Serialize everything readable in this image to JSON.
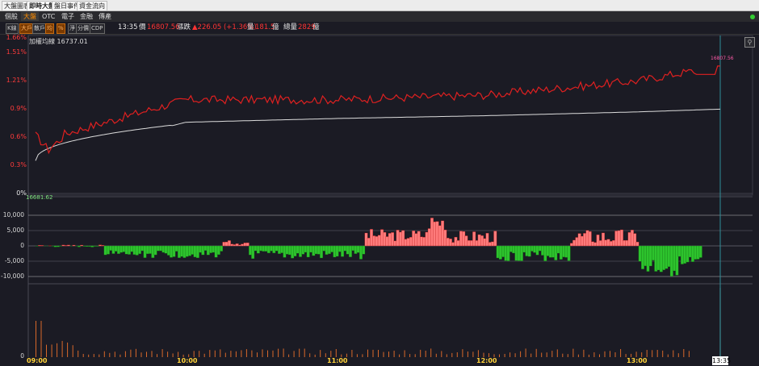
{
  "top_tabs": [
    "大盤圖表",
    "即時大盤",
    "盤日事件",
    "資金流向"
  ],
  "sub_tabs": [
    "個股",
    "大盤",
    "OTC",
    "電子",
    "金融",
    "傳產"
  ],
  "toolbar": {
    "buttons": [
      "K線",
      "大戶",
      "散戶",
      "均",
      "%",
      "淨",
      "分價",
      "CDP"
    ],
    "active_buttons": [
      "大戶",
      "均",
      "%"
    ]
  },
  "quote": {
    "time": "13:35",
    "price_label": "價",
    "price": "16807.56",
    "change_label": "漲跌",
    "change": "▲226.05 (+1.36%)",
    "volume_label": "量",
    "volume": "181.5",
    "volume_unit": "億",
    "total_label": "總量",
    "total": "2829",
    "total_unit": "億"
  },
  "main_chart": {
    "header_label": "加權均線 16737.01",
    "last_price_label": "16807.56",
    "y_ticks": [
      "1.66%",
      "1.51%",
      "1.21%",
      "0.9%",
      "0.6%",
      "0.3%",
      "0%"
    ],
    "colors": {
      "price_line": "#e02020",
      "avg_line": "#dcdcdc",
      "background": "#1b1b24"
    }
  },
  "flow_chart": {
    "top_label": "16681.62",
    "y_ticks": [
      "10,000",
      "5,000",
      "0",
      "-5,000",
      "-10,000"
    ],
    "colors": {
      "positive": "#ff7b7b",
      "negative": "#2dc32d"
    }
  },
  "volume_chart": {
    "y_ticks": [
      "0"
    ],
    "color": "#d8682a"
  },
  "x_axis": {
    "ticks": [
      "09:00",
      "10:00",
      "11:00",
      "12:00",
      "13:00"
    ],
    "current_time_box": "13:35"
  },
  "chart_data": {
    "type": "line",
    "title": "",
    "x": [
      "09:00",
      "10:00",
      "11:00",
      "12:00",
      "13:00",
      "13:35"
    ],
    "ylim": [
      0,
      1.66
    ],
    "series": [
      {
        "values": [
          0.55,
          1.0,
          1.0,
          1.05,
          1.2,
          1.36
        ]
      },
      {
        "values": [
          0.35,
          0.76,
          0.8,
          0.83,
          0.87,
          0.9
        ]
      }
    ]
  }
}
